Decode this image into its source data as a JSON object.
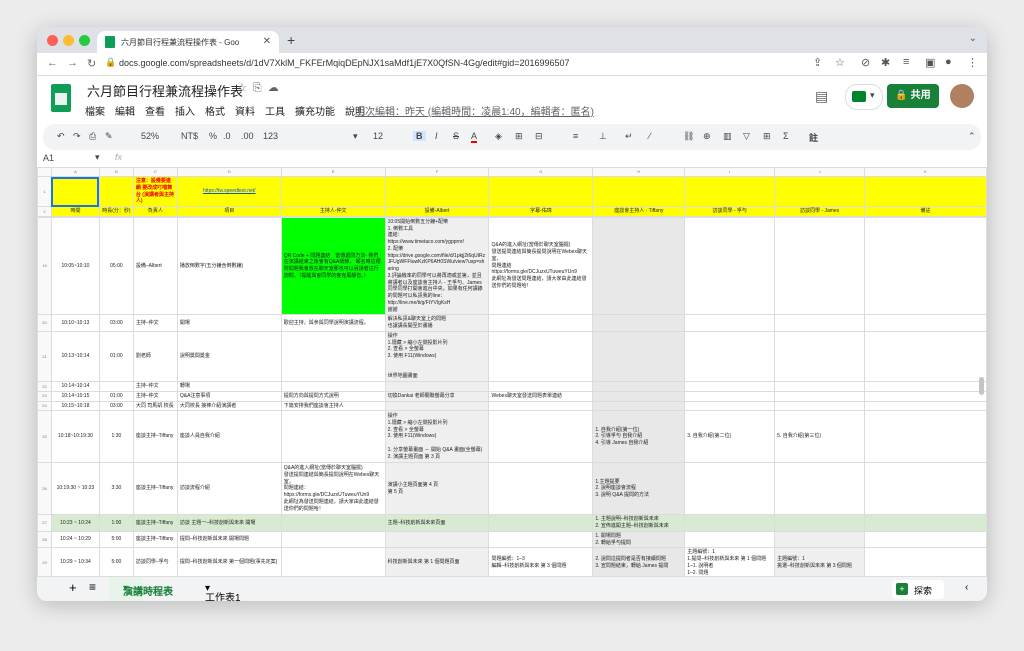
{
  "browser": {
    "tab_title": "六月節目行程兼流程操作表 - Goo",
    "url": "docs.google.com/spreadsheets/d/1dV7XklM_FKFErMqiqDEpNJX1saMdf1jE7X0QfSN-4Gg/edit#gid=2016996507"
  },
  "doc": {
    "title": "六月節目行程兼流程操作表",
    "menus": [
      "檔案",
      "編輯",
      "查看",
      "插入",
      "格式",
      "資料",
      "工具",
      "擴充功能",
      "說明"
    ],
    "last_edit": "上次編輯：昨天 (編輯時間：凌晨1:40，編輯者：匿名)",
    "share_label": "共用"
  },
  "toolbar": {
    "zoom": "52%",
    "currency": "NT$",
    "percent": "%",
    "dec_less": ".0",
    "dec_more": ".00",
    "number_format": "123",
    "font_size": "12",
    "bold": "B",
    "italic": "I",
    "strike": "S",
    "text_color": "A",
    "note": "註"
  },
  "formula_bar": {
    "cell_ref": "A1",
    "fx": "fx"
  },
  "grid": {
    "col_letters": [
      "",
      "A",
      "B",
      "C",
      "D",
      "E",
      "F",
      "G",
      "H",
      "I",
      "J",
      "K"
    ],
    "row_numbers": [
      "1",
      "2",
      "3",
      "19",
      "20",
      "21",
      "22",
      "23",
      "24",
      "25",
      "26",
      "27",
      "28",
      "29",
      "30",
      "31"
    ],
    "row1": {
      "notice": "注意：設備要連網 要改成叮噹舞台 (演講者與主持人)",
      "speedtest": "https://tw.speedtest.net/"
    },
    "header": [
      "時間",
      "時長(分：秒)",
      "負責人",
      "項目",
      "主持人-仲文",
      "設備-Albert",
      "字幕-佑瑋",
      "座談會主持人 - Tiffany",
      "訪談同學 - 孚勻",
      "訪談同學 - James",
      "備註"
    ],
    "rows": [
      {
        "time": "10:05~10:10",
        "dur": "05:00",
        "owner": "設備–Albert",
        "item": "播放倒數字(五分鐘含倒數鐘)",
        "host": "QR Code + 問題連結　當傳遞問方法- 我們在演講結束之後會有Q&A環節， 報名時這裡附問題我會放在聊天室那也可以另請者這行詢問。（提醒與會同學的麥克風靜音。）",
        "device": "10:05開始倒數五分鐘+配樂\n1. 倒數工具\n連結：\nhttps://www.timetaco.com/ygpprnr/\n2. 配樂\nhttps://drive.google.com/file/d/1pkjj2t6qUtRzJFUgWFFtuwKzKP6AH0SWu/view?usp=sharing\n3.評論機率的同學可以將再適或並第，並且將講者以及座談會主持人 - 王孚勻、James同學同學打開會進台中央，如果有任何講錄的問題可以私訊我的line：\nhttp://line.me/ti/g/FtYVIgKsH\n謝謝",
        "caption": "Q&A的進入網址(當傳於聊天室腦擺)\n發送提問連結與簡長提問說明在Webex聊天室，\n問題連結\nhttps://forms.gle/DCJuzxUTuweuYUn9\n此網址為發送問題連結，請大家由此連結發送你們的問題哈！"
      },
      {
        "time": "10:10~10:13",
        "dur": "03:00",
        "owner": "主持–仲文",
        "item": "開場",
        "host": "歡迎主持，與參與同學說明演講流程。",
        "device": "解決私訊&聊天室上的問題\n也讓講長開至於畫播"
      },
      {
        "time": "10:13~10:14",
        "dur": "01:00",
        "owner": "劉老師",
        "item": "說明獎間獎金",
        "device": "操作\n1.隱藏 > 縮小左側投影片列\n2. 查看 > 全螢幕\n3. 使用 F11(Windows)\n\n\n世界地圖畫面"
      },
      {
        "time": "10:14~10:14",
        "dur": "",
        "owner": "主持–仲文",
        "item": "轉場"
      },
      {
        "time": "10:14~10:15",
        "dur": "01:00",
        "owner": "主持–仲文",
        "item": "Q&A注意事項",
        "host": "提問方向與提問方式說明",
        "device": "切換Dankai 老師關聯螢幕分享",
        "caption": "Webex聊天室發送問題表單連結"
      },
      {
        "time": "10:15~10:18",
        "dur": "03:00",
        "owner": "大同 司馬凱 校長",
        "item": "大同校長 接棒介紹演講者",
        "host": "下篇安排我們座談會主持人"
      },
      {
        "time": "10:18~10:19:30",
        "dur": "1:30",
        "owner": "座談主持–Tiffany",
        "item": "座談人員自我介紹",
        "device": "操作\n1.隱藏 > 縮小左側投影片列\n2. 查看 > 全螢幕\n3. 使用 F11(Windows)\n\n1. 分享螢幕畫面 － 開始 Q&A 畫面(全螢幕)\n2. 演講主題頁面 第 3 頁",
        "tiffany": "1. 自我介紹(第一位)\n2. 引導孚勻 自我介紹\n4. 引導 James 自我介紹",
        "fuyun": "3. 自我介紹(第二位)",
        "james": "5. 自我介紹(第三位)"
      },
      {
        "time": "10:19:30 ~ 10:23",
        "dur": "3:30",
        "owner": "座談主持–Tiffany",
        "item": "訪談流程介紹",
        "host": "Q&A的進入網址(當傳於聊天室腦擺)\n發送提問連結與簡長提問說明在Webex聊天室，\n問題連結：\nhttps://forms.gle/DCJuzxUTuweuYUn9\n此網址為發送問題連結，請大家由此連結發送你們的問題哈！",
        "device": "演講小主題頁面第 4 頁\n第 5 頁",
        "tiffany": "1.主題提要\n2. 說明座談會流程\n3. 說明 Q&A 提問的方法"
      },
      {
        "time": "10:23 ~ 10:24",
        "dur": "1:00",
        "owner": "座談主持–Tiffany",
        "item": "訪談 主題一–科技創新與未來 開場",
        "device": "主題–科技創新與未來頁面",
        "tiffany": "1. 主題說明–科技創新與未來\n2. 宣佈進開主題–科技創新與未來"
      },
      {
        "time": "10:24 ~ 10:29",
        "dur": "5:00",
        "owner": "座談主持–Tiffany",
        "item": "提問–科技創新與未來 開場問題",
        "tiffany": "1. 開場問題\n2. 轉給孚勻提問"
      },
      {
        "time": "10:29 ~ 10:34",
        "dur": "5:00",
        "owner": "訪談同學–孚勻",
        "item": "提問–科技創新與未來 第一個問題(事先定案)",
        "device": "科技創新與未來 第 1 個問題頁面",
        "caption": "問題編號：1–3\n編輯–科技創新與未來 第 3 個問題",
        "tiffany": "2. 說問這提問者是否有接續問題\n3. 宣問題結束，轉給 James 提問",
        "fuyun": "主題編號：1\n1.提問–科技創新與未來 第 1 個問題\n1–1. 說明者\n1–2. 問題",
        "james": "主題編號：1\n挑選–科技創新與未來 第 3 個問題"
      },
      {
        "time": "10:34 ~ 10:39",
        "dur": "5:00",
        "owner": "訪談同學–James",
        "item": "提問–科技創新與未來 第二個問題(事先定案)",
        "device": "科技創新與未來 第 2 個問題頁面",
        "caption": "問題編號：1–4\n編輯–科技創新與未來 第 4 個問題",
        "tiffany": "2. 說問這提問者是否有接續問題\n3. 宣問題結束，轉給 孚勻 提問",
        "fuyun": "主題編號：1\n挑選–科技創新與未來 第 4 個問題",
        "james": "主題編號：1\n1.提問–科技創新與未來 第 2 個問題\n1–1. 說明者\n1–2. 問題"
      },
      {
        "time": "10:39 ~ 10:44",
        "dur": "5:00",
        "owner": "訪談同學–孚勻",
        "item": "提問–科技創新與未來 第三個問題(事先定案)",
        "device": "科技創新與未來 第 3 個問題頁面",
        "caption": "問題編號：1–5\n編輯–科技創新與未來 第 5 個問題",
        "tiffany": "2. 說問這提問者是否有接續問題\n3. 宣問題結束，轉給 James 提問",
        "fuyun": "主題編號：1\n1.提問–科技創新與未來 第 3 個問題",
        "james": "主題編號：1\n挑選–科技創新與未來 第 5 個問題"
      }
    ]
  },
  "sheets": {
    "add": "+",
    "list": "≡",
    "active": "演講時程表",
    "other": "工作表1",
    "explore": "探索"
  },
  "colors": {
    "accent_green": "#188038",
    "highlight_yellow": "#ffff00",
    "highlight_lime": "#00ff00",
    "link": "#1155cc"
  }
}
